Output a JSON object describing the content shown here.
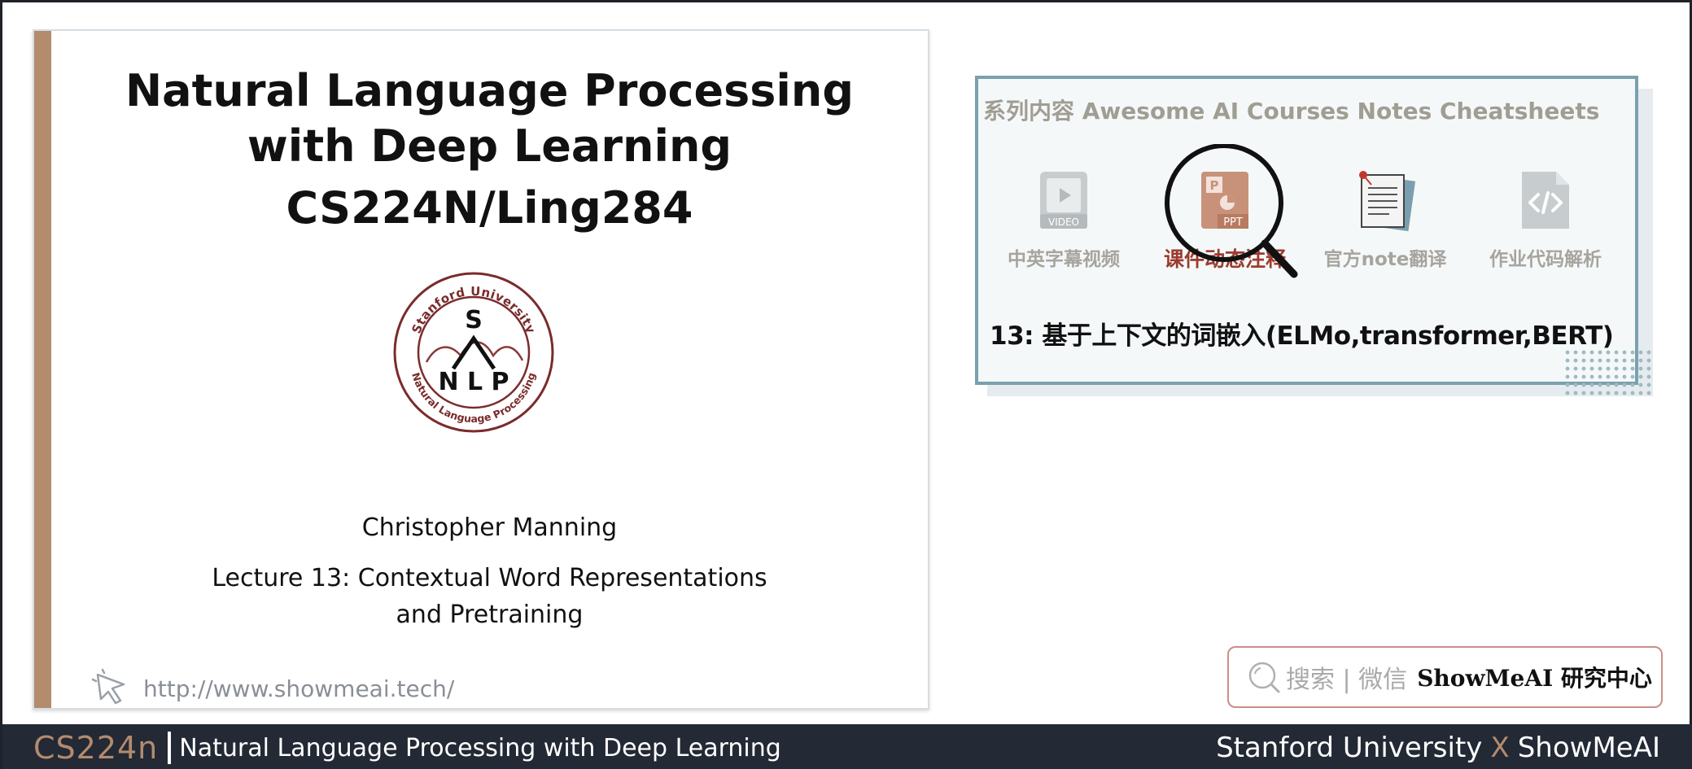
{
  "slide": {
    "title_line1": "Natural Language Processing",
    "title_line2": "with Deep Learning",
    "title_line3": "CS224N/Ling284",
    "seal": {
      "top_text": "Stanford University",
      "bottom_text": "Natural Language Processing",
      "letter_top": "S",
      "letters_bottom": "N L P"
    },
    "author": "Christopher Manning",
    "lecture_line1": "Lecture 13: Contextual Word Representations",
    "lecture_line2": "and Pretraining",
    "url": "http://www.showmeai.tech/",
    "accent_color": "#b38b6d"
  },
  "series_card": {
    "title": "系列内容 Awesome AI Courses Notes Cheatsheets",
    "tiles": [
      {
        "label": "中英字幕视频",
        "icon": "video-icon",
        "badge": "VIDEO"
      },
      {
        "label": "课件动态注释",
        "icon": "ppt-icon",
        "badge": "PPT",
        "active": true
      },
      {
        "label": "官方note翻译",
        "icon": "document-icon"
      },
      {
        "label": "作业代码解析",
        "icon": "code-file-icon"
      }
    ],
    "lecture_title": "13: 基于上下文的词嵌入(ELMo,transformer,BERT)",
    "border_color": "#7aa1ad",
    "active_color": "#9c3b2f"
  },
  "search": {
    "hint": "搜索 | 微信",
    "brand": "ShowMeAI 研究中心"
  },
  "footer": {
    "course_code": "CS224n",
    "course_name": "Natural Language Processing with Deep Learning",
    "left_brand": "Stanford University",
    "x": "X",
    "right_brand": "ShowMeAI"
  }
}
